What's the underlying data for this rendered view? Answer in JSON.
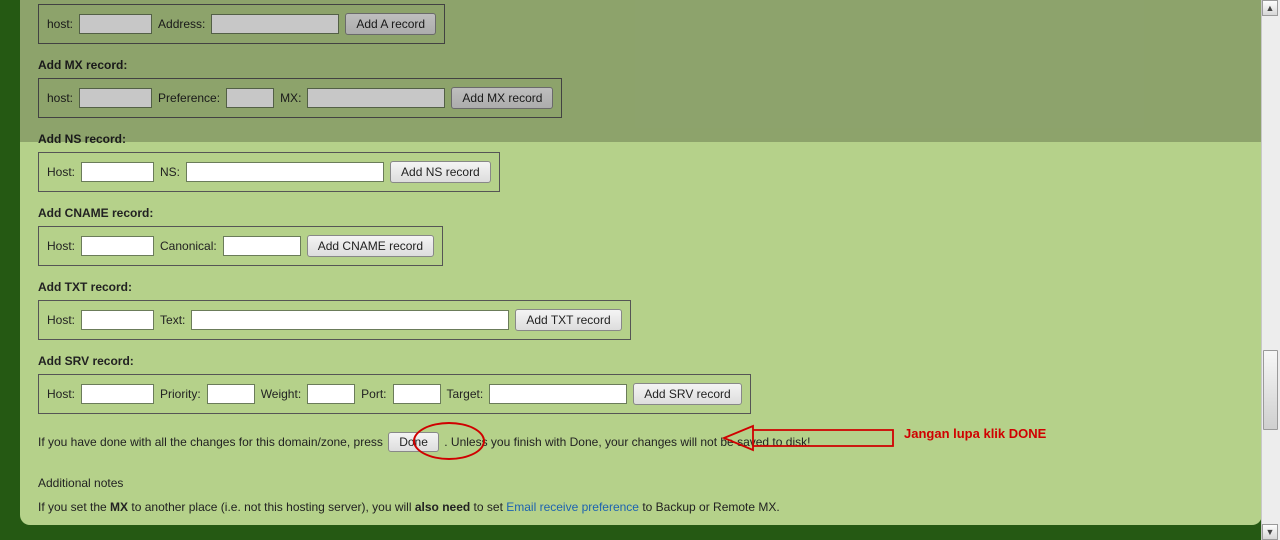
{
  "a": {
    "host_label": "host:",
    "address_label": "Address:",
    "btn": "Add A record"
  },
  "mx": {
    "title": "Add MX record:",
    "host_label": "host:",
    "pref_label": "Preference:",
    "mx_label": "MX:",
    "btn": "Add MX record"
  },
  "ns": {
    "title": "Add NS record:",
    "host_label": "Host:",
    "ns_label": "NS:",
    "btn": "Add NS record"
  },
  "cname": {
    "title": "Add CNAME record:",
    "host_label": "Host:",
    "canonical_label": "Canonical:",
    "btn": "Add CNAME record"
  },
  "txt": {
    "title": "Add TXT record:",
    "host_label": "Host:",
    "text_label": "Text:",
    "btn": "Add TXT record"
  },
  "srv": {
    "title": "Add SRV record:",
    "host_label": "Host:",
    "priority_label": "Priority:",
    "weight_label": "Weight:",
    "port_label": "Port:",
    "target_label": "Target:",
    "btn": "Add SRV record"
  },
  "done": {
    "pre": "If you have done with all the changes for this domain/zone, press ",
    "btn": "Done",
    "post": " . Unless you finish with Done, your changes will not be saved to disk!"
  },
  "annotation": {
    "text": "Jangan lupa klik DONE"
  },
  "notes": {
    "title": "Additional notes",
    "p1a": "If you set the ",
    "mx": "MX",
    "p1b": " to another place (i.e. not this hosting server), you will ",
    "bold": "also need",
    "p1c": " to set ",
    "link": "Email receive preference",
    "p1d": " to Backup or Remote MX."
  }
}
